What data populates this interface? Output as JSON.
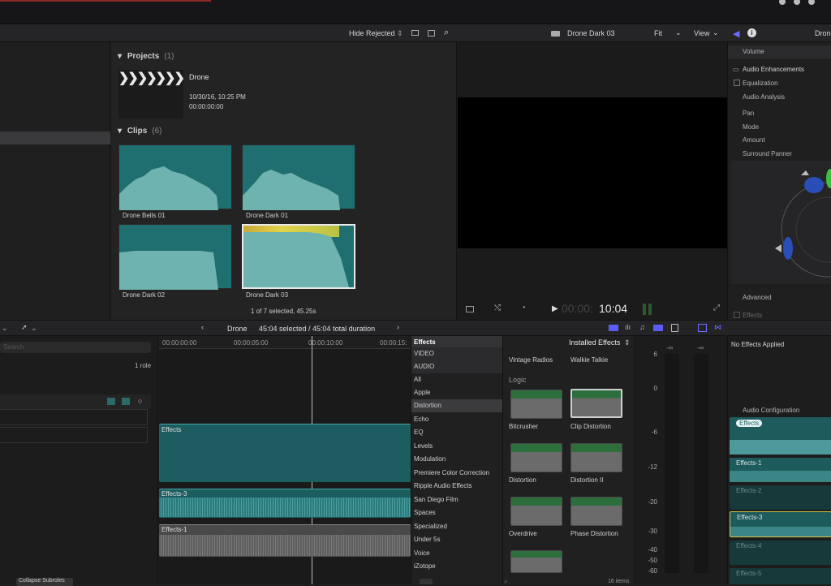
{
  "toolbar": {
    "hide_rejected": "Hide Rejected",
    "viewer_title": "Drone Dark 03",
    "fit": "Fit",
    "view": "View",
    "inspector_title": "Drone"
  },
  "browser": {
    "projects_header": "Projects",
    "projects_count": "(1)",
    "project_name": "Drone",
    "project_date": "10/30/16, 10:25 PM",
    "project_tc": "00:00:00:00",
    "clips_header": "Clips",
    "clips_count": "(6)",
    "clips": [
      "Drone Bells 01",
      "Drone Dark 01",
      "Drone Dark 02",
      "Drone Dark 03"
    ],
    "selection_status": "1 of 7 selected, 45.25s"
  },
  "viewer": {
    "timecode_dim": "00:00:",
    "timecode": "10:04"
  },
  "inspector": {
    "volume": "Volume",
    "audio_enhancements": "Audio Enhancements",
    "equalization": "Equalization",
    "audio_analysis": "Audio Analysis",
    "pan": "Pan",
    "mode": "Mode",
    "amount": "Amount",
    "surround_panner": "Surround Panner",
    "advanced": "Advanced",
    "effects": "Effects",
    "no_effects": "No Effects Applied"
  },
  "timeline_bar": {
    "project": "Drone",
    "duration": "45:04 selected / 45:04 total duration"
  },
  "index": {
    "search_placeholder": "Search",
    "roles": "1 role"
  },
  "timeline": {
    "ticks": [
      "00:00:00:00",
      "00:00:05:00",
      "00:00:10:00",
      "00:00:15:"
    ],
    "clips": [
      "Effects",
      "Effects-3",
      "Effects-1"
    ]
  },
  "effects_browser": {
    "title": "Effects",
    "installed": "Installed Effects",
    "categories": [
      "VIDEO",
      "AUDIO",
      "All",
      "Apple",
      "Distortion",
      "Echo",
      "EQ",
      "Levels",
      "Modulation",
      "Premiere Color Correction",
      "Ripple Audio Effects",
      "San Diego Film",
      "Spaces",
      "Specialized",
      "Under 5s",
      "Voice",
      "iZotope"
    ],
    "top_items": [
      "Vintage Radios",
      "Walkie Talkie"
    ],
    "group": "Logic",
    "items": [
      "Bitcrusher",
      "Clip Distortion",
      "Distortion",
      "Distortion II",
      "Overdrive",
      "Phase Distortion"
    ],
    "item_count": "16 items"
  },
  "meter": {
    "labels": [
      "6",
      "0",
      "-6",
      "-12",
      "-20",
      "-30",
      "-40",
      "-50",
      "-60"
    ],
    "inf": [
      "-∞",
      "-∞"
    ]
  },
  "audio_config": {
    "title": "Audio Configuration",
    "components": [
      "Effects",
      "Effects-1",
      "Effects-2",
      "Effects-3",
      "Effects-4",
      "Effects-5"
    ]
  },
  "bottom": {
    "collapse": "Collapse Subroles"
  },
  "colors": {
    "teal": "#1f6e70",
    "accent_blue": "#5b5bf5",
    "selection_yellow": "#d6c44b"
  }
}
